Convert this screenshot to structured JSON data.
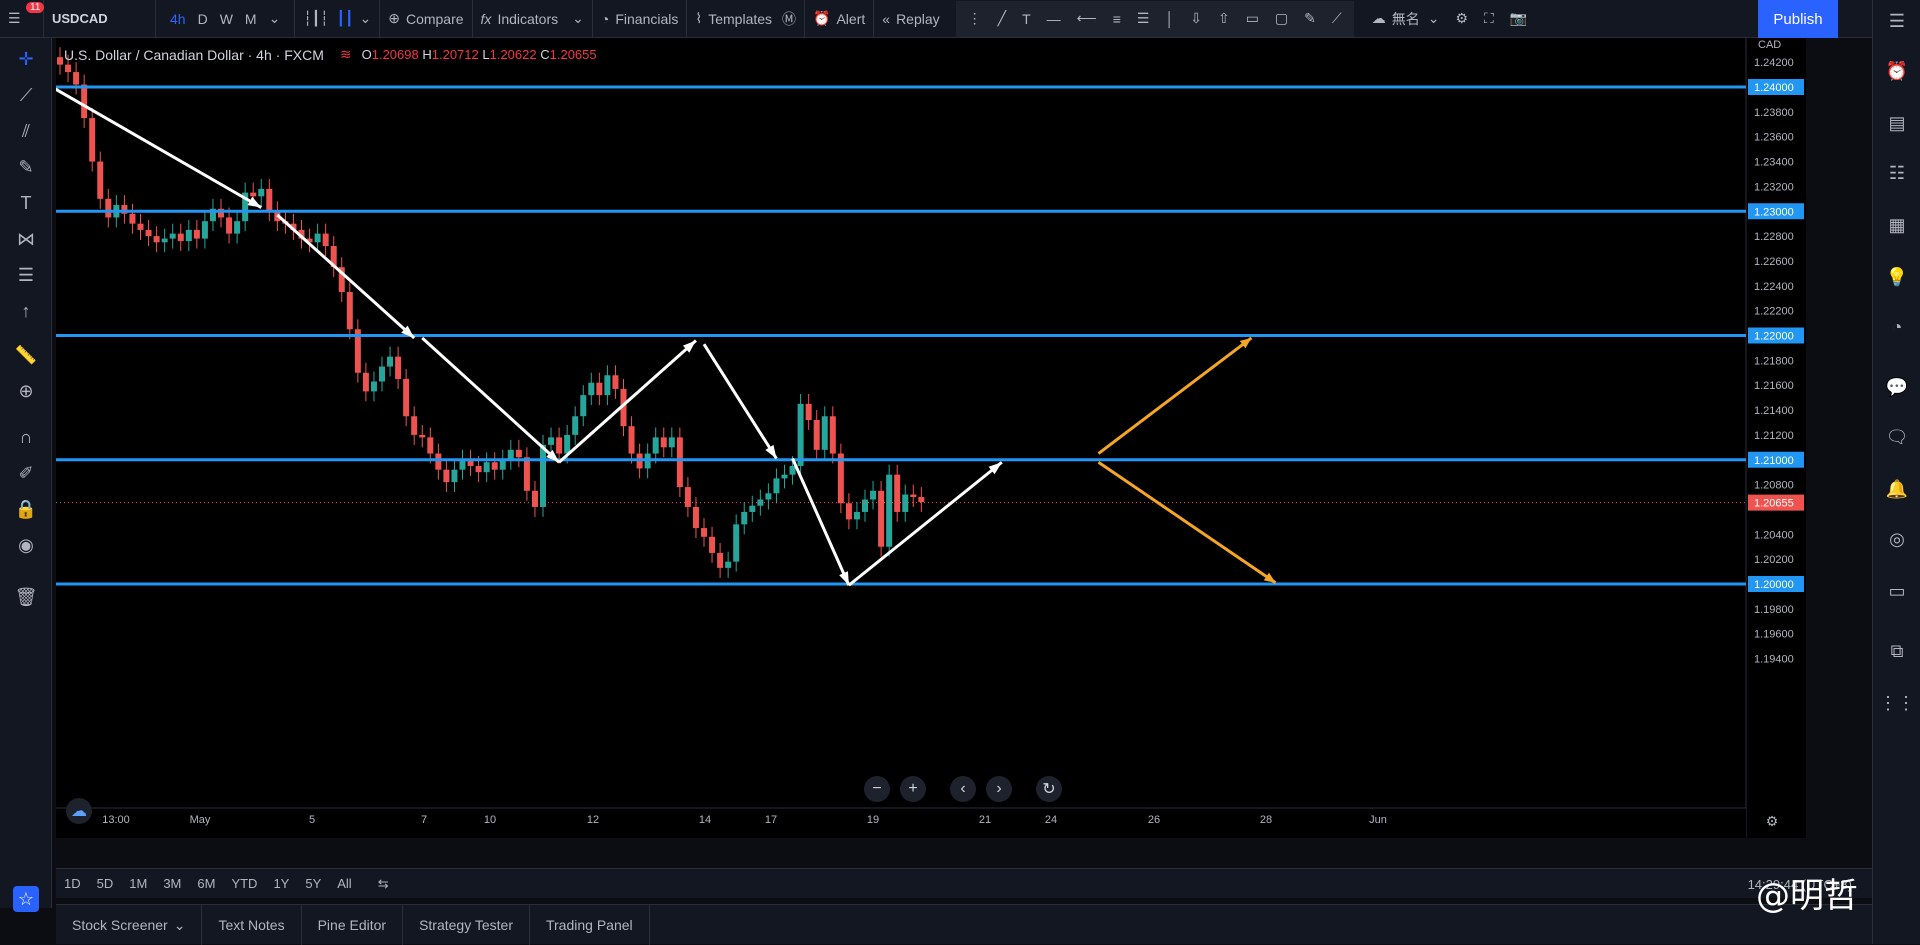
{
  "topbar": {
    "badge": "11",
    "symbol": "USDCAD",
    "timeframes": [
      "4h",
      "D",
      "W",
      "M"
    ],
    "compare": "Compare",
    "indicators": "Indicators",
    "financials": "Financials",
    "templates": "Templates",
    "alert": "Alert",
    "replay": "Replay",
    "layout_name": "無名",
    "publish": "Publish"
  },
  "legend": {
    "title": "U.S. Dollar / Canadian Dollar · 4h · FXCM",
    "o_label": "O",
    "o": "1.20698",
    "h_label": "H",
    "h": "1.20712",
    "l_label": "L",
    "l": "1.20622",
    "c_label": "C",
    "c": "1.20655"
  },
  "price_axis": {
    "currency": "CAD",
    "ticks": [
      "1.24200",
      "1.23800",
      "1.23600",
      "1.23400",
      "1.23200",
      "1.22800",
      "1.22600",
      "1.22400",
      "1.22200",
      "1.21800",
      "1.21600",
      "1.21400",
      "1.21200",
      "1.20800",
      "1.20400",
      "1.20200",
      "1.19800",
      "1.19600",
      "1.19400"
    ],
    "tick_values": [
      1.242,
      1.238,
      1.236,
      1.234,
      1.232,
      1.228,
      1.226,
      1.224,
      1.222,
      1.218,
      1.216,
      1.214,
      1.212,
      1.208,
      1.204,
      1.202,
      1.198,
      1.196,
      1.194
    ],
    "hlines": [
      {
        "label": "1.24000",
        "value": 1.24
      },
      {
        "label": "1.23000",
        "value": 1.23
      },
      {
        "label": "1.22000",
        "value": 1.22
      },
      {
        "label": "1.21000",
        "value": 1.21
      },
      {
        "label": "1.20000",
        "value": 1.2
      }
    ],
    "last": {
      "label": "1.20655",
      "value": 1.20655
    }
  },
  "time_axis": {
    "labels": [
      "13:00",
      "May",
      "5",
      "7",
      "10",
      "12",
      "14",
      "17",
      "19",
      "21",
      "24",
      "26",
      "28",
      "Jun"
    ]
  },
  "bottom": {
    "ranges": [
      "1D",
      "5D",
      "1M",
      "3M",
      "6M",
      "YTD",
      "1Y",
      "5Y",
      "All"
    ],
    "clock": "14:29:44 (UTC+8)"
  },
  "panels": [
    "Stock Screener",
    "Text Notes",
    "Pine Editor",
    "Strategy Tester",
    "Trading Panel"
  ],
  "watermark": "@明哲",
  "colors": {
    "up": "#26a69a",
    "down": "#ef5350",
    "hline": "#2196f3",
    "accent": "#2962ff",
    "projection": "#f5a623"
  },
  "chart_data": {
    "type": "candlestick",
    "symbol": "USDCAD",
    "interval": "4h",
    "closes": [
      1.2418,
      1.2412,
      1.2402,
      1.2375,
      1.234,
      1.231,
      1.2295,
      1.2305,
      1.2298,
      1.229,
      1.2285,
      1.228,
      1.2275,
      1.2278,
      1.2282,
      1.2276,
      1.2285,
      1.2278,
      1.2292,
      1.2302,
      1.2295,
      1.2282,
      1.2292,
      1.2315,
      1.2312,
      1.2318,
      1.23,
      1.2292,
      1.229,
      1.2285,
      1.2278,
      1.2275,
      1.2282,
      1.2272,
      1.2255,
      1.2235,
      1.2205,
      1.217,
      1.2155,
      1.2163,
      1.2175,
      1.2183,
      1.2165,
      1.2135,
      1.212,
      1.2118,
      1.2105,
      1.2092,
      1.2082,
      1.2092,
      1.21,
      1.2095,
      1.209,
      1.2098,
      1.2092,
      1.21,
      1.2108,
      1.2102,
      1.2075,
      1.2062,
      1.2112,
      1.2118,
      1.2105,
      1.212,
      1.2135,
      1.2152,
      1.2162,
      1.2152,
      1.2168,
      1.2157,
      1.2127,
      1.2105,
      1.2093,
      1.2105,
      1.2118,
      1.211,
      1.2118,
      1.2078,
      1.2062,
      1.2045,
      1.2038,
      1.2025,
      1.2013,
      1.2018,
      1.2048,
      1.2058,
      1.2063,
      1.2068,
      1.2073,
      1.2085,
      1.2088,
      1.2095,
      1.2145,
      1.2132,
      1.2108,
      1.2135,
      1.2105,
      1.2065,
      1.2052,
      1.2058,
      1.2068,
      1.2075,
      1.203,
      1.2088,
      1.2058,
      1.2072,
      1.207,
      1.2066
    ]
  }
}
